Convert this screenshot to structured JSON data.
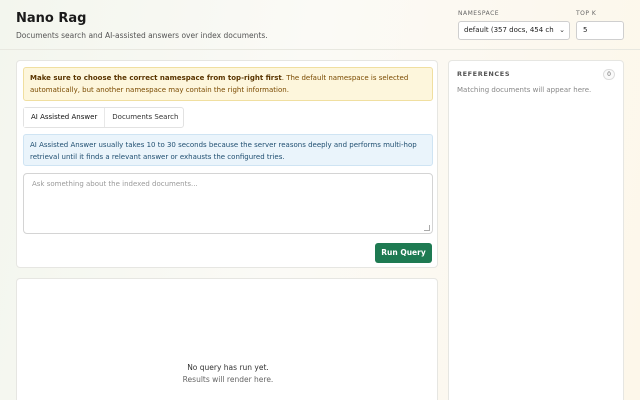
{
  "header": {
    "title": "Nano Rag",
    "subtitle": "Documents search and AI-assisted answers over index documents.",
    "namespace_label": "NAMESPACE",
    "namespace_value": "default (357 docs, 454 ch",
    "topk_label": "TOP K",
    "topk_value": "5"
  },
  "query": {
    "warning_bold": "Make sure to choose the correct namespace from top-right first",
    "warning_rest": ". The default namespace is selected automatically, but another namespace may contain the right information.",
    "tabs": [
      {
        "label": "AI Assisted Answer",
        "active": true
      },
      {
        "label": "Documents Search",
        "active": false
      }
    ],
    "info": "AI Assisted Answer usually takes 10 to 30 seconds because the server reasons deeply and performs multi-hop retrieval until it finds a relevant answer or exhausts the configured tries.",
    "placeholder": "Ask something about the indexed documents...",
    "run_label": "Run Query"
  },
  "results": {
    "empty_title": "No query has run yet.",
    "empty_sub": "Results will render here."
  },
  "references": {
    "title": "REFERENCES",
    "count": "0",
    "empty": "Matching documents will appear here."
  }
}
